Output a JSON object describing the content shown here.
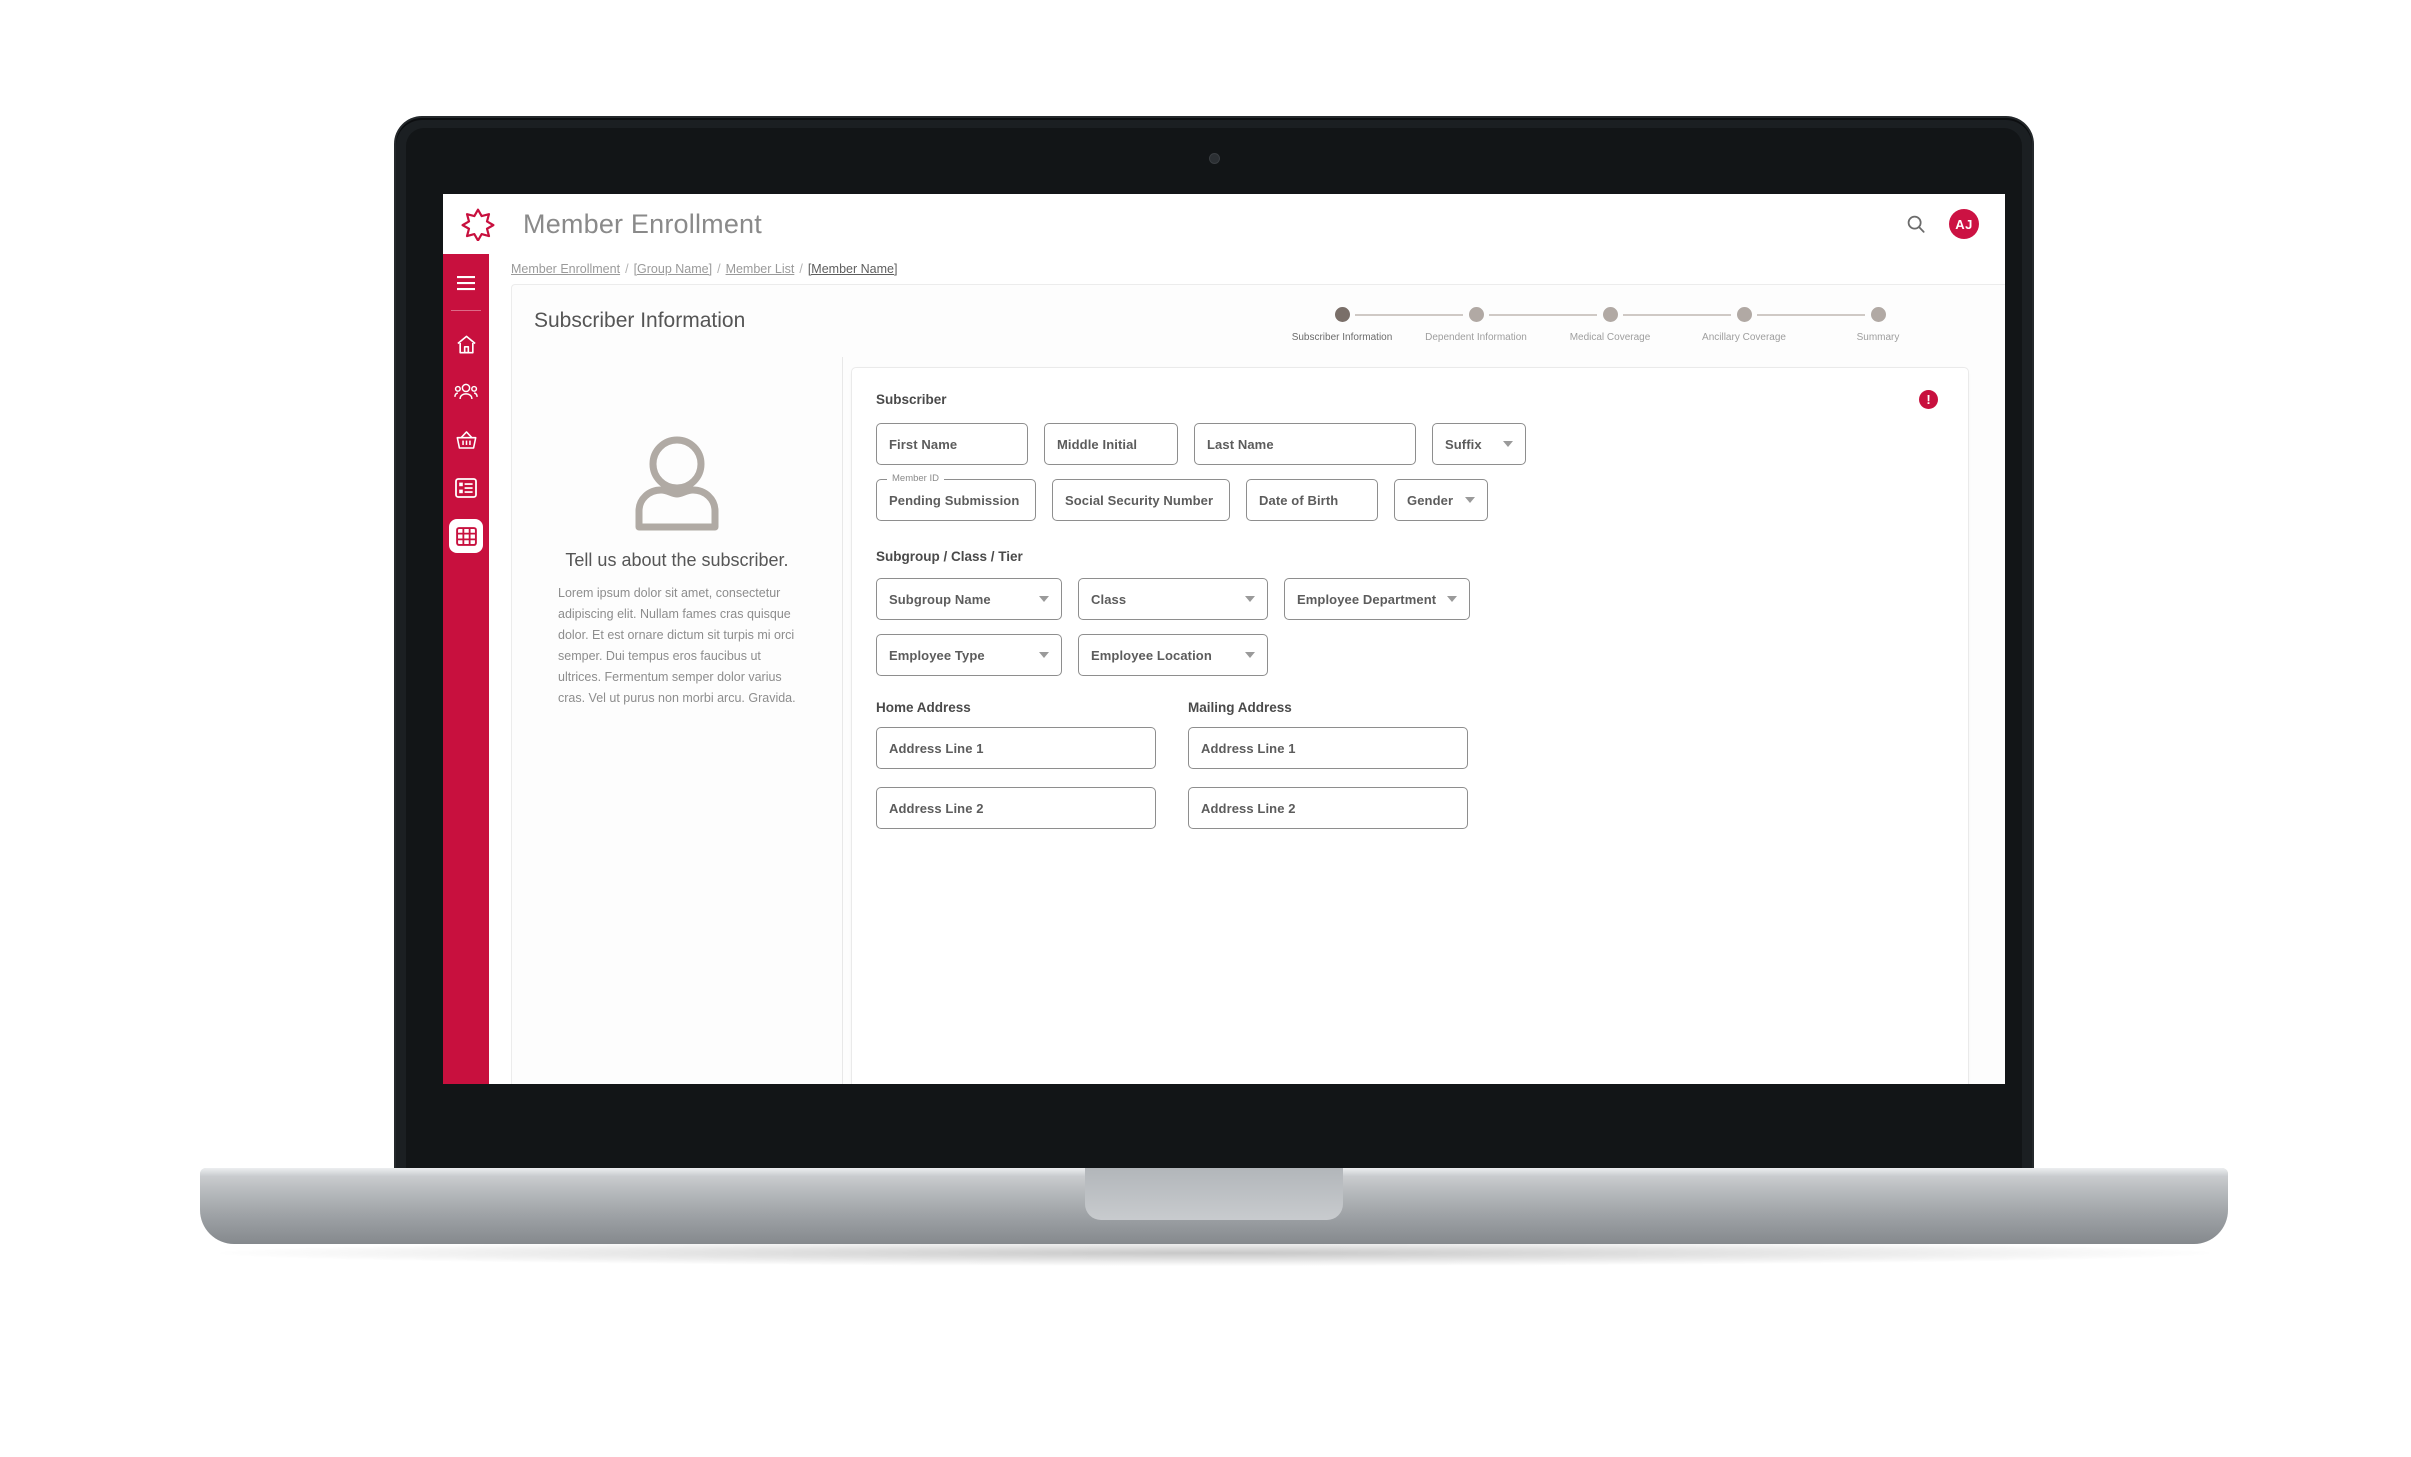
{
  "brand": {
    "accent": "#C8103E",
    "logo_icon": "asterisk-medical-logo",
    "app_title": "Member Enrollment"
  },
  "topbar": {
    "search_icon": "search-icon",
    "avatar_initials": "AJ"
  },
  "sidebar": {
    "items": [
      {
        "icon": "hamburger-menu-icon",
        "name": "menu",
        "active": false
      },
      {
        "icon": "home-icon",
        "name": "home",
        "active": false
      },
      {
        "icon": "group-people-icon",
        "name": "groups",
        "active": false
      },
      {
        "icon": "basket-icon",
        "name": "products",
        "active": false
      },
      {
        "icon": "list-icon",
        "name": "reports",
        "active": false
      },
      {
        "icon": "grid-table-icon",
        "name": "enrollment",
        "active": true
      }
    ]
  },
  "breadcrumb": {
    "items": [
      "Member Enrollment",
      "[Group Name]",
      "Member List",
      "[Member Name]"
    ],
    "separator": "/"
  },
  "page": {
    "title": "Subscriber Information"
  },
  "stepper": {
    "steps": [
      {
        "label": "Subscriber Information",
        "state": "active"
      },
      {
        "label": "Dependent Information",
        "state": "upcoming"
      },
      {
        "label": "Medical Coverage",
        "state": "upcoming"
      },
      {
        "label": "Ancillary Coverage",
        "state": "upcoming"
      },
      {
        "label": "Summary",
        "state": "upcoming"
      }
    ]
  },
  "left_pane": {
    "illustration_icon": "person-avatar-icon",
    "heading": "Tell us about the subscriber.",
    "body": "Lorem ipsum dolor sit amet, consectetur adipiscing elit. Nullam fames cras quisque dolor. Et est ornare dictum sit turpis mi orci semper. Dui tempus eros faucibus ut ultrices. Fermentum semper dolor varius cras. Vel ut purus non morbi arcu. Gravida."
  },
  "form": {
    "subscriber": {
      "heading": "Subscriber",
      "error_icon": "error-alert-icon",
      "error_glyph": "!",
      "fields": {
        "first_name": "First Name",
        "middle_initial": "Middle Initial",
        "last_name": "Last Name",
        "suffix": "Suffix",
        "member_id_label": "Member ID",
        "member_id_value": "Pending Submission",
        "ssn": "Social Security Number",
        "dob": "Date of Birth",
        "gender": "Gender"
      }
    },
    "subgroup": {
      "heading": "Subgroup / Class / Tier",
      "fields": {
        "subgroup_name": "Subgroup Name",
        "class": "Class",
        "employee_department": "Employee Department",
        "employee_type": "Employee Type",
        "employee_location": "Employee Location"
      }
    },
    "home_address": {
      "heading": "Home Address",
      "line1": "Address Line 1",
      "line2": "Address Line 2"
    },
    "mailing_address": {
      "heading": "Mailing Address",
      "line1": "Address Line 1",
      "line2": "Address Line 2"
    }
  }
}
